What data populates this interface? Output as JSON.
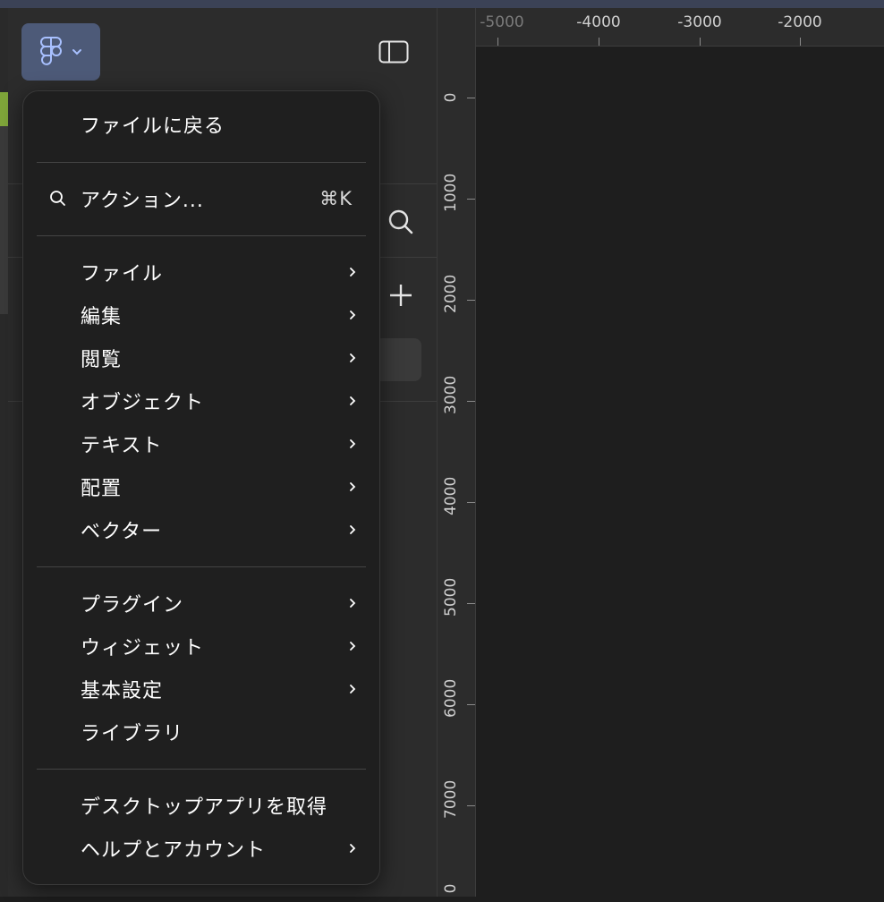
{
  "canvas": {
    "ruler_x_labels": [
      "-5000",
      "-4000",
      "-3000",
      "-2000"
    ],
    "ruler_y_labels": [
      "0",
      "1000",
      "2000",
      "3000",
      "4000",
      "5000",
      "6000",
      "7000",
      "0"
    ]
  },
  "main_menu": {
    "back_to_files": "ファイルに戻る",
    "actions": {
      "label": "アクション...",
      "shortcut": "⌘K"
    },
    "group1": [
      {
        "label": "ファイル",
        "submenu": true
      },
      {
        "label": "編集",
        "submenu": true
      },
      {
        "label": "閲覧",
        "submenu": true
      },
      {
        "label": "オブジェクト",
        "submenu": true
      },
      {
        "label": "テキスト",
        "submenu": true
      },
      {
        "label": "配置",
        "submenu": true
      },
      {
        "label": "ベクター",
        "submenu": true
      }
    ],
    "group2": [
      {
        "label": "プラグイン",
        "submenu": true
      },
      {
        "label": "ウィジェット",
        "submenu": true
      },
      {
        "label": "基本設定",
        "submenu": true
      },
      {
        "label": "ライブラリ",
        "submenu": false
      }
    ],
    "group3": [
      {
        "label": "デスクトップアプリを取得",
        "submenu": false
      },
      {
        "label": "ヘルプとアカウント",
        "submenu": true
      }
    ]
  },
  "icons": {
    "main_menu_button": "figma-logo-icon",
    "sidebar_toggle": "sidebar-toggle-icon",
    "search": "search-icon",
    "add": "plus-icon"
  },
  "colors": {
    "menu_bg": "#1f1f1f",
    "active_button": "#4d5a78",
    "panel_bg": "#2c2c2c",
    "canvas_bg": "#1e1e1e"
  }
}
